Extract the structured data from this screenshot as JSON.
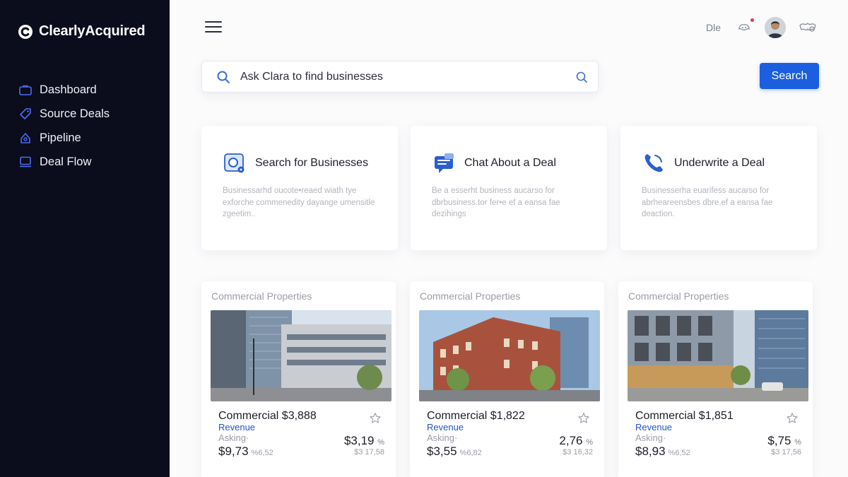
{
  "brand": {
    "name": "ClearlyAcquired"
  },
  "sidebar": {
    "items": [
      {
        "label": "Dashboard",
        "icon": "briefcase-icon"
      },
      {
        "label": "Source Deals",
        "icon": "tag-icon"
      },
      {
        "label": "Pipeline",
        "icon": "pipeline-icon"
      },
      {
        "label": "Deal Flow",
        "icon": "monitor-icon"
      }
    ]
  },
  "header": {
    "lang": "Dle",
    "icons": [
      "menu-icon",
      "notification-icon",
      "avatar",
      "settings-icon"
    ],
    "notification_color": "#e5393b"
  },
  "search": {
    "placeholder": "Ask Clara to find businesses",
    "button_label": "Search"
  },
  "features": [
    {
      "title": "Search for Businesses",
      "icon": "search-business-icon",
      "desc": "Businessarhd oucote•reaed wiath tye exforche commenedity dayange umensitle zgeetim.."
    },
    {
      "title": "Chat About a Deal",
      "icon": "chat-icon",
      "desc": "Be a esserht business aucarso for dbrbusiness.tor fer•e ef a eansa fae dezihings"
    },
    {
      "title": "Underwrite a Deal",
      "icon": "phone-icon",
      "desc": "Businesserha euarifess aucarso for abrheareensbes dbre.ef a eansa fae deaction."
    }
  ],
  "properties": [
    {
      "category": "Commercial Properties",
      "title": "Commercial $3,888",
      "revenue": "Revenue",
      "asking": "Asking·",
      "price": "$9,73",
      "price_sub": "%6,52",
      "metric": "$3,19",
      "metric_unit": "%",
      "metric_sub": "$3 17,58"
    },
    {
      "category": "Commercial Properties",
      "title": "Commercial $1,822",
      "revenue": "Revenue",
      "asking": "Asking·",
      "price": "$3,55",
      "price_sub": "%6,82",
      "metric": "2,76",
      "metric_unit": "%",
      "metric_sub": "$3 16,32"
    },
    {
      "category": "Commercial Properties",
      "title": "Commercial $1,851",
      "revenue": "Revenue",
      "asking": "Asking·",
      "price": "$8,93",
      "price_sub": "%6,52",
      "metric": "$,75",
      "metric_unit": "%",
      "metric_sub": "$3 17,56"
    }
  ],
  "colors": {
    "sidebar_bg": "#0b0c1c",
    "accent": "#1b5fe0",
    "revenue_text": "#2156c9"
  }
}
